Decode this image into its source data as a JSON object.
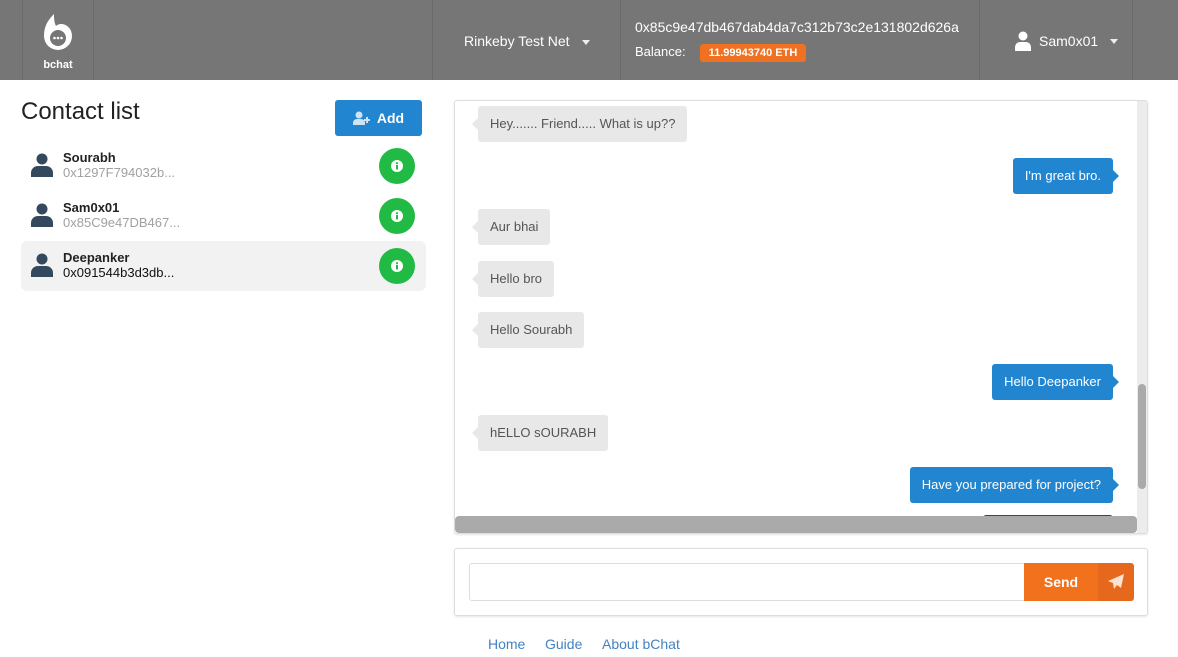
{
  "header": {
    "logo_text": "bchat",
    "network": "Rinkeby Test Net",
    "address": "0x85c9e47db467dab4da7c312b73c2e131802d626a",
    "balance_label": "Balance:",
    "balance": "11.99943740 ETH",
    "user": "Sam0x01"
  },
  "contacts": {
    "title": "Contact list",
    "add_label": "Add",
    "items": [
      {
        "name": "Sourabh",
        "address": "0x1297F794032b..."
      },
      {
        "name": "Sam0x01",
        "address": "0x85C9e47DB467..."
      },
      {
        "name": "Deepanker",
        "address": "0x091544b3d3db...",
        "selected": true
      }
    ]
  },
  "messages": [
    {
      "text": "Hey....... Friend..... What is up??",
      "dir": "in"
    },
    {
      "text": "I'm great bro.",
      "dir": "out"
    },
    {
      "text": "Aur bhai",
      "dir": "in"
    },
    {
      "text": "Hello bro",
      "dir": "in"
    },
    {
      "text": "Hello Sourabh",
      "dir": "in"
    },
    {
      "text": "Hello Deepanker",
      "dir": "out"
    },
    {
      "text": "hELLO sOURABH",
      "dir": "in"
    },
    {
      "text": "Have you prepared for project?",
      "dir": "out"
    }
  ],
  "composer": {
    "value": "",
    "send_label": "Send"
  },
  "footer": {
    "links": [
      "Home",
      "Guide",
      "About bChat"
    ]
  },
  "colors": {
    "header": "#767676",
    "primary": "#2185d0",
    "orange": "#f2711c",
    "green": "#21ba45"
  }
}
